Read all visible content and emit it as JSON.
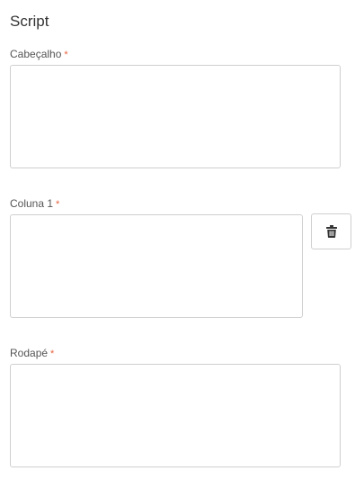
{
  "section": {
    "title": "Script"
  },
  "fields": {
    "header": {
      "label": "Cabeçalho",
      "required_mark": "*",
      "value": ""
    },
    "column1": {
      "label": "Coluna 1",
      "required_mark": "*",
      "value": ""
    },
    "footer": {
      "label": "Rodapé",
      "required_mark": "*",
      "value": ""
    }
  },
  "actions": {
    "delete_column_icon": "trash-icon"
  },
  "colors": {
    "required": "#e8623e",
    "border": "#cfcfcf",
    "icon": "#333333"
  }
}
